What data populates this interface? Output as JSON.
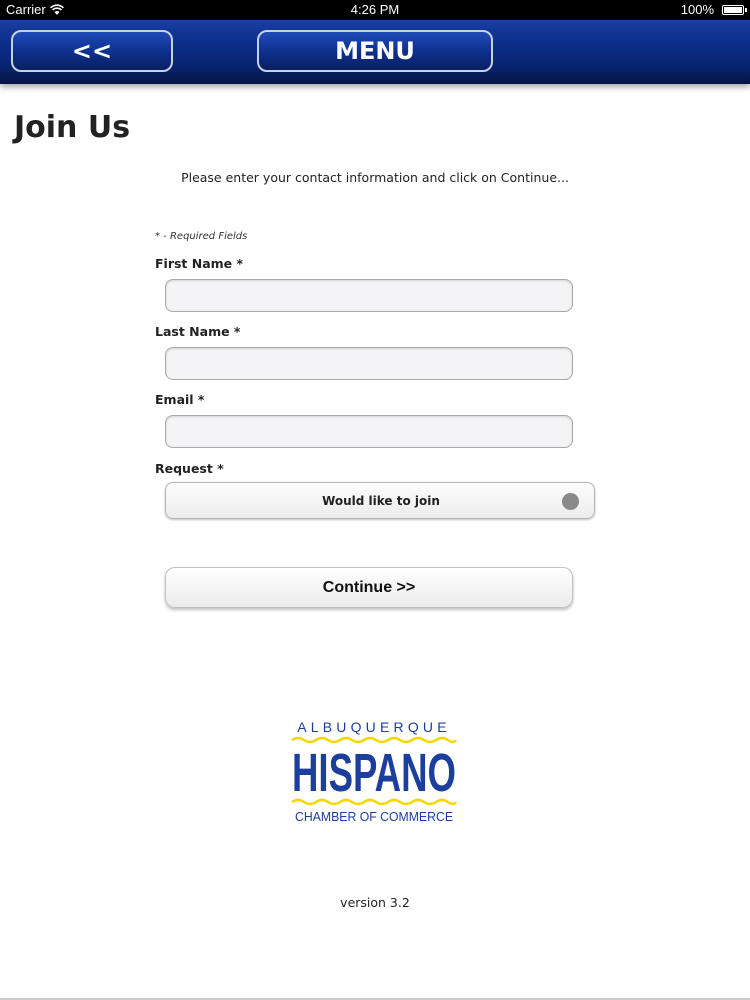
{
  "status_bar": {
    "carrier": "Carrier",
    "time": "4:26 PM",
    "battery": "100%"
  },
  "nav": {
    "back_label": "<<",
    "menu_label": "MENU"
  },
  "page": {
    "title": "Join Us",
    "instructions": "Please enter your contact information and click on Continue...",
    "required_note": "* - Required Fields"
  },
  "form": {
    "first_name": {
      "label": "First Name *",
      "value": ""
    },
    "last_name": {
      "label": "Last Name *",
      "value": ""
    },
    "email": {
      "label": "Email *",
      "value": ""
    },
    "request": {
      "label": "Request *",
      "value": "Would like to join"
    },
    "continue_label": "Continue >>"
  },
  "logo": {
    "line1": "ALBUQUERQUE",
    "line2": "HISPANO",
    "line3": "CHAMBER OF COMMERCE",
    "colors": {
      "blue": "#1c3f9e",
      "yellow": "#f5d800"
    }
  },
  "footer": {
    "version": "version 3.2"
  },
  "colors": {
    "nav_bar": "#0c2f8c",
    "status_bar": "#000000"
  }
}
